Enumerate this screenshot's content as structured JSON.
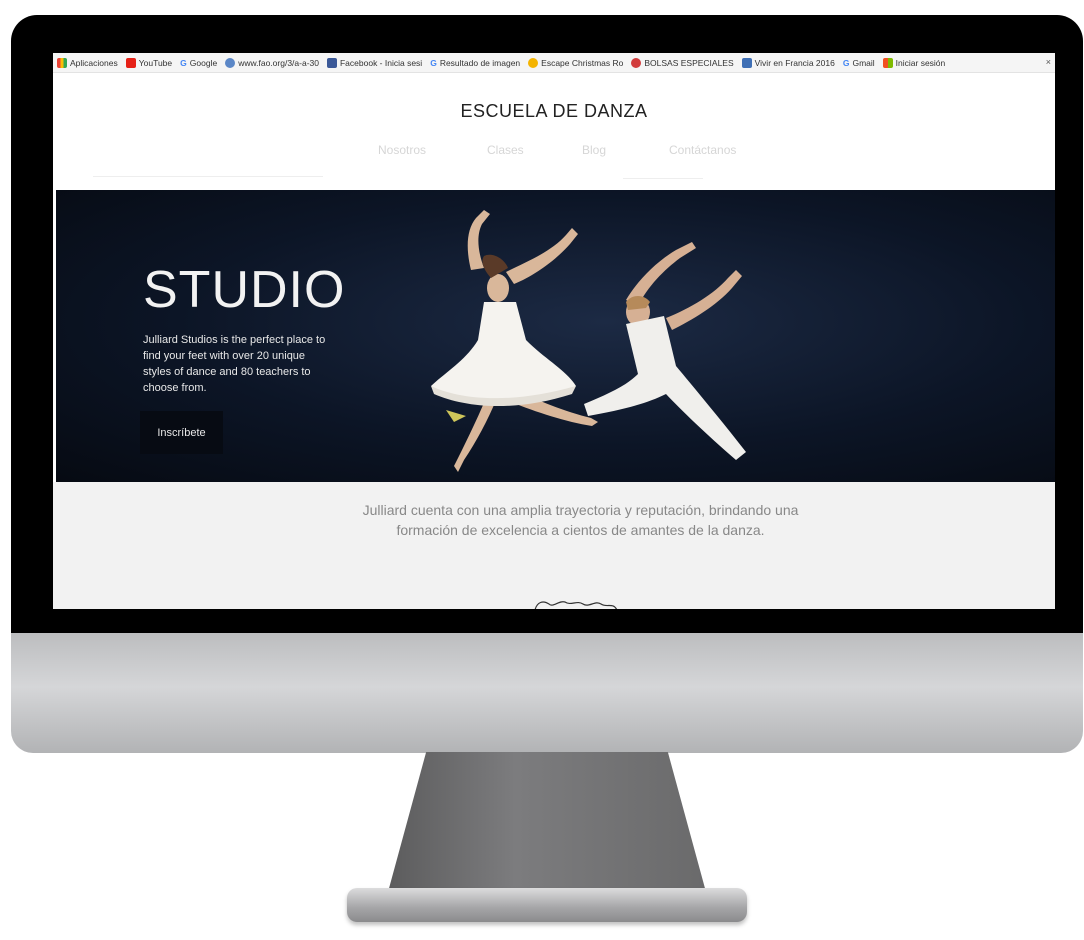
{
  "bookmarks": [
    {
      "label": "Aplicaciones",
      "icon": "apps-grid-icon",
      "color": "#4285f4"
    },
    {
      "label": "YouTube",
      "icon": "youtube-icon",
      "color": "#e62117"
    },
    {
      "label": "Google",
      "icon": "google-g-icon",
      "color": "#4285f4"
    },
    {
      "label": "www.fao.org/3/a-a-30",
      "icon": "fao-globe-icon",
      "color": "#5b87c7"
    },
    {
      "label": "Facebook - Inicia sesi",
      "icon": "facebook-icon",
      "color": "#3b5998"
    },
    {
      "label": "Resultado de imagen",
      "icon": "google-g-icon",
      "color": "#4285f4"
    },
    {
      "label": "Escape Christmas Ro",
      "icon": "smiley-icon",
      "color": "#f4b400"
    },
    {
      "label": "BOLSAS ESPECIALES",
      "icon": "bolsas-icon",
      "color": "#d23c3c"
    },
    {
      "label": "Vivir en Francia 2016",
      "icon": "page-icon",
      "color": "#3f6fb5"
    },
    {
      "label": "Gmail",
      "icon": "google-g-icon",
      "color": "#4285f4"
    },
    {
      "label": "Iniciar sesión",
      "icon": "microsoft-icon",
      "color": "#f25022"
    }
  ],
  "site": {
    "title": "ESCUELA DE DANZA",
    "nav": [
      "Nosotros",
      "Clases",
      "Blog",
      "Contáctanos"
    ]
  },
  "hero": {
    "title": "STUDIO",
    "description": "Julliard Studios is the perfect place to find your feet with over 20 unique styles of dance and 80 teachers to choose from.",
    "button": "Inscríbete"
  },
  "tagline": "Julliard cuenta con una amplia trayectoria y reputación, brindando una formación de excelencia a cientos de amantes de la danza.",
  "colors": {
    "hero_bg": "#0c1526",
    "button_bg": "#070b13",
    "nav_text": "#d6d6d6",
    "band_bg": "#f2f2f2"
  }
}
